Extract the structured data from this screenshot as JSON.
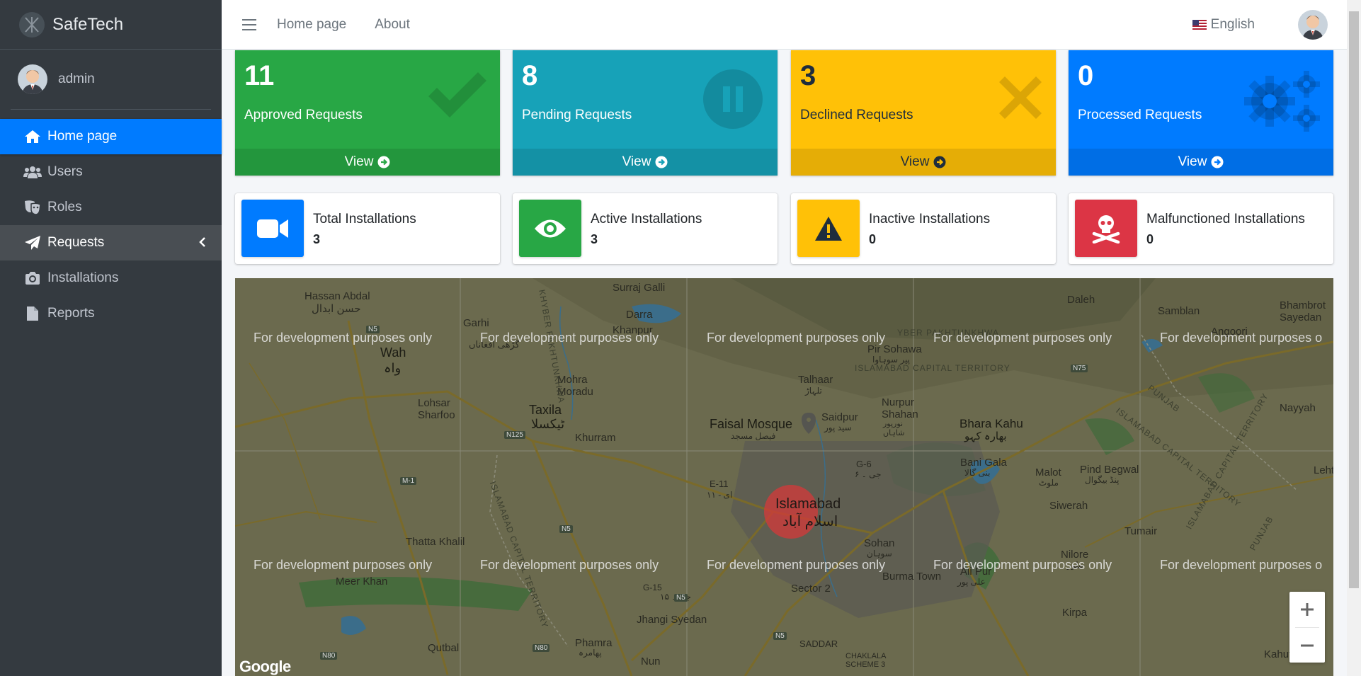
{
  "brand": {
    "name": "SafeTech"
  },
  "user": {
    "name": "admin"
  },
  "sidebar": {
    "items": [
      {
        "label": "Home page",
        "icon": "home-icon"
      },
      {
        "label": "Users",
        "icon": "users-icon"
      },
      {
        "label": "Roles",
        "icon": "masks-icon"
      },
      {
        "label": "Requests",
        "icon": "paper-plane-icon"
      },
      {
        "label": "Installations",
        "icon": "camera-icon"
      },
      {
        "label": "Reports",
        "icon": "file-icon"
      }
    ]
  },
  "topnav": {
    "links": [
      "Home page",
      "About"
    ],
    "language": "English"
  },
  "stats": [
    {
      "count": "11",
      "label": "Approved Requests",
      "footer": "View",
      "color": "#28a745",
      "icon": "check-icon"
    },
    {
      "count": "8",
      "label": "Pending Requests",
      "footer": "View",
      "color": "#17a2b8",
      "icon": "pause-icon"
    },
    {
      "count": "3",
      "label": "Declined Requests",
      "footer": "View",
      "color": "#ffc107",
      "icon": "x-icon"
    },
    {
      "count": "0",
      "label": "Processed Requests",
      "footer": "View",
      "color": "#007bff",
      "icon": "gears-icon"
    }
  ],
  "info": [
    {
      "title": "Total Installations",
      "value": "3",
      "color": "#007bff",
      "icon": "video-camera-icon"
    },
    {
      "title": "Active Installations",
      "value": "3",
      "color": "#28a745",
      "icon": "eye-icon"
    },
    {
      "title": "Inactive Installations",
      "value": "0",
      "color": "#ffc107",
      "icon": "warning-icon"
    },
    {
      "title": "Malfunctioned Installations",
      "value": "0",
      "color": "#dc3545",
      "icon": "skull-crossbones-icon"
    }
  ],
  "map": {
    "watermark": "For development purposes only",
    "watermark_cut": "For development purposes o",
    "provider": "Google",
    "places": {
      "hassan_abdal": "Hassan Abdal",
      "hassan_abdal_ur": "حسن ابدال",
      "surraj_galli": "Surraj Galli",
      "darra": "Darra",
      "khanpur": "Khanpur",
      "garhi": "Garhi",
      "garhi_ur": "گڑھی افغاناں",
      "wah": "Wah",
      "wah_ur": "واہ",
      "mohra_moradu": "Mohra\nMoradu",
      "lohsar_sharfoo": "Lohsar\nSharfoo",
      "taxila": "Taxila",
      "taxila_ur": "ٹیکسلا",
      "khurram": "Khurram",
      "faisal_mosque": "Faisal Mosque",
      "faisal_mosque_ur": "فیصل مسجد",
      "saidpur": "Saidpur",
      "saidpur_ur": "سید پور",
      "talhaar": "Talhaar",
      "talhaar_ur": "تلہاڑ",
      "pir_sohawa": "Pir Sohawa",
      "pir_sohawa_ur": "پیر سوہاوا",
      "nurpur_shahan": "Nurpur\nShahan",
      "nurpur_ur": "نورپور\nشاہاں",
      "bhara_kahu": "Bhara Kahu",
      "bhara_kahu_ur": "بھارہ کہو",
      "daleh": "Daleh",
      "samblan": "Samblan",
      "bhambrot": "Bhambrot\nSayedan",
      "angoori": "Angoori",
      "nayyah": "Nayyah",
      "bani_gala": "Bani Gala",
      "bani_gala_ur": "بنی گالا",
      "malot": "Malot",
      "malot_ur": "ملوٹ",
      "pind_begwal": "Pind Begwal",
      "pind_begwal_ur": "پنڈ بیگوال",
      "siwerah": "Siwerah",
      "tumair": "Tumair",
      "nilore": "Nilore",
      "nilore_ur": "نیلور",
      "lehtrar": "Lehtr",
      "e11": "E-11",
      "e11_ur": "ای - ۱۱",
      "g6": "G-6",
      "g6_ur": "جی ۔ ۶",
      "islamabad": "Islamabad",
      "islamabad_ur": "اسلام آباد",
      "sohan": "Sohan",
      "sohan_ur": "سوہان",
      "burma_town": "Burma Town",
      "ali_pur": "Ali Pur",
      "ali_pur_ur": "علی پور",
      "thatta_khalil": "Thatta Khalil",
      "meer_khan": "Meer Khan",
      "g15": "G-15",
      "g15_ur": "جی ۔ ۱۵",
      "sector2": "Sector 2",
      "jhangi_syedan": "Jhangi Syedan",
      "kirpa": "Kirpa",
      "qutbal": "Qutbal",
      "phamra": "Phamra",
      "phamra_ur": "پھامرہ",
      "nun": "Nun",
      "saddar": "SADDAR",
      "chaklala": "CHAKLALA\nSCHEME 3",
      "kahuta": "Kahuta",
      "kp_label": "KHYBER PAKHTUNKHWA",
      "kp_label_cut": "YBER PAKHTUNKHWA",
      "ict_label": "ISLAMABAD CAPITAL TERRITORY",
      "punjab": "PUNJAB",
      "n5": "N5",
      "n125": "N125",
      "m1": "M-1",
      "n80": "N80",
      "n75": "N75"
    }
  }
}
